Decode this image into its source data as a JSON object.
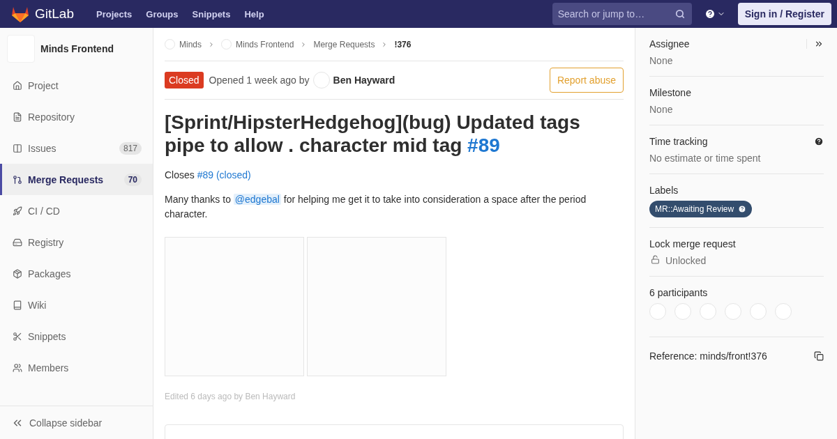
{
  "navbar": {
    "logo_text": "GitLab",
    "links": [
      "Projects",
      "Groups",
      "Snippets",
      "Help"
    ],
    "search": {
      "placeholder": "Search or jump to…"
    },
    "sign_in": "Sign in / Register"
  },
  "sidebar": {
    "project": "Minds Frontend",
    "items": [
      {
        "label": "Project",
        "selected": false
      },
      {
        "label": "Repository",
        "selected": false
      },
      {
        "label": "Issues",
        "count": "817",
        "selected": false
      },
      {
        "label": "Merge Requests",
        "count": "70",
        "selected": true
      },
      {
        "label": "CI / CD",
        "selected": false
      },
      {
        "label": "Registry",
        "selected": false
      },
      {
        "label": "Packages",
        "selected": false
      },
      {
        "label": "Wiki",
        "selected": false
      },
      {
        "label": "Snippets",
        "selected": false
      },
      {
        "label": "Members",
        "selected": false
      }
    ],
    "collapse": "Collapse sidebar"
  },
  "breadcrumbs": [
    {
      "label": "Minds",
      "avatar": true
    },
    {
      "label": "Minds Frontend",
      "avatar": true
    },
    {
      "label": "Merge Requests",
      "avatar": false
    },
    {
      "label": "!376",
      "avatar": false
    }
  ],
  "header": {
    "status": "Closed",
    "opened": "Opened 1 week ago by",
    "author": "Ben Hayward",
    "report": "Report abuse"
  },
  "title": {
    "text": "[Sprint/HipsterHedgehog](bug) Updated tags pipe to allow . character mid tag",
    "link": "#89"
  },
  "description": [
    {
      "parts": [
        {
          "kind": "text",
          "text": "Closes "
        },
        {
          "kind": "link",
          "text": "#89 (closed)"
        }
      ]
    },
    {
      "parts": [
        {
          "kind": "text",
          "text": "Many thanks to "
        },
        {
          "kind": "mention",
          "text": "@edgebal"
        },
        {
          "kind": "text",
          "text": " for helping me get it to take into consideration a space after the period character."
        }
      ]
    }
  ],
  "edited": "Edited 6 days ago by Ben Hayward",
  "right_sidebar": {
    "sections": [
      {
        "kind": "plain",
        "title": "Assignee",
        "value": "None"
      },
      {
        "kind": "plain",
        "title": "Milestone",
        "value": "None"
      },
      {
        "kind": "help",
        "title": "Time tracking",
        "value": "No estimate or time spent"
      },
      {
        "kind": "labels",
        "title": "Labels",
        "labels": [
          {
            "text": "MR::Awaiting Review",
            "color": "#334d6d"
          }
        ]
      },
      {
        "kind": "lock",
        "title": "Lock merge request",
        "value": "Unlocked"
      },
      {
        "kind": "participants",
        "title": "6 participants",
        "avatars": [
          {
            "kind": "avatar"
          },
          {
            "kind": "avatar"
          },
          {
            "kind": "avatar"
          },
          {
            "kind": "avatar"
          },
          {
            "kind": "avatar"
          },
          {
            "kind": "avatar"
          }
        ]
      },
      {
        "kind": "reference",
        "title": "Reference: minds/front!376"
      }
    ]
  }
}
